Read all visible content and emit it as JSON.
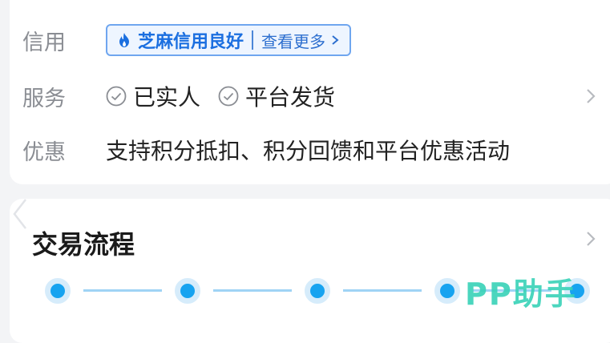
{
  "info_card": {
    "credit": {
      "label": "信用",
      "badge_main": "芝麻信用良好",
      "badge_more": "查看更多"
    },
    "service": {
      "label": "服务",
      "items": [
        "已实人",
        "平台发货"
      ]
    },
    "discount": {
      "label": "优惠",
      "text": "支持积分抵扣、积分回馈和平台优惠活动"
    }
  },
  "trade_flow": {
    "title": "交易流程",
    "step_count": 5
  },
  "watermark": "PP助手",
  "colors": {
    "accent_blue": "#1b6fe0",
    "timeline_dot": "#17a3f0",
    "watermark": "#38d2b8"
  },
  "icons": [
    "flame-icon",
    "chevron-right-icon",
    "check-circle-icon",
    "chevron-left-icon"
  ]
}
